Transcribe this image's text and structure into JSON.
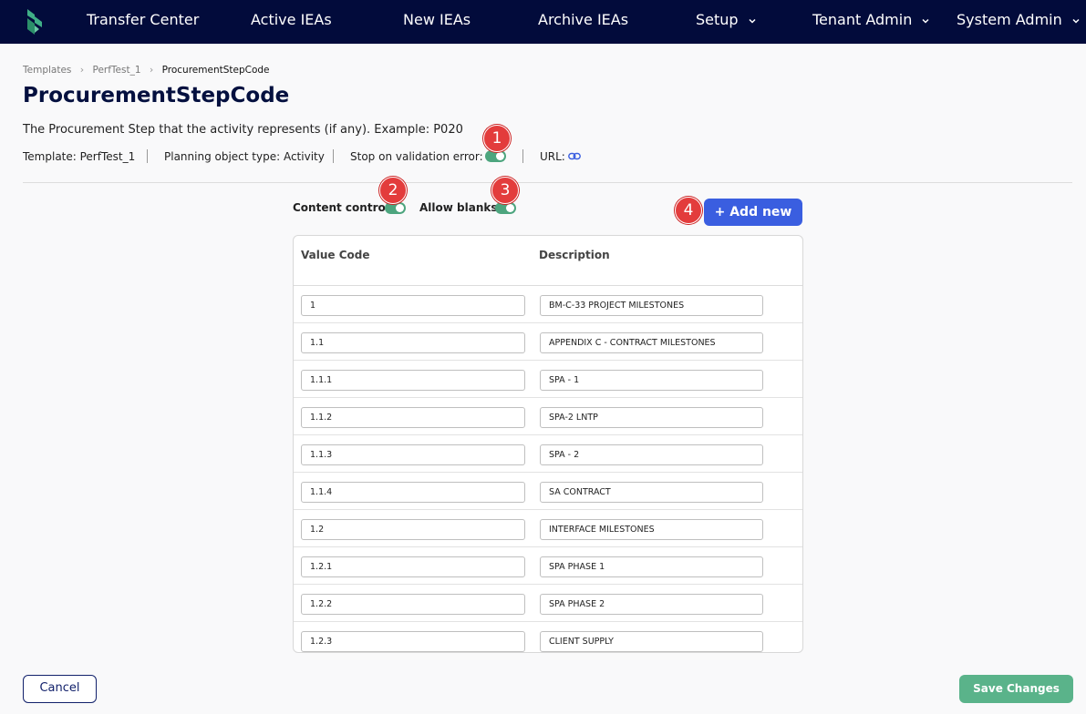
{
  "nav": {
    "items": [
      {
        "label": "Transfer Center"
      },
      {
        "label": "Active IEAs"
      },
      {
        "label": "New IEAs"
      },
      {
        "label": "Archive IEAs"
      },
      {
        "label": "Setup"
      },
      {
        "label": "Tenant Admin"
      },
      {
        "label": "System Admin"
      }
    ]
  },
  "breadcrumb": [
    "Templates",
    "PerfTest_1",
    "ProcurementStepCode"
  ],
  "page": {
    "title": "ProcurementStepCode",
    "description": "The Procurement Step that the activity represents (if any). Example: P020"
  },
  "meta": {
    "template": "Template: PerfTest_1",
    "planning_object_type": "Planning object type: Activity",
    "stop_on_validation_error_label": "Stop on validation error:",
    "stop_on_validation_error": true,
    "url_label": "URL:"
  },
  "controls": {
    "content_control_label": "Content control:",
    "content_control": true,
    "allow_blanks_label": "Allow blanks:",
    "allow_blanks": true,
    "add_new_label": "+ Add new"
  },
  "badges": [
    "1",
    "2",
    "3",
    "4"
  ],
  "table": {
    "columns": [
      "Value Code",
      "Description"
    ],
    "rows": [
      {
        "code": "1",
        "description": "BM-C-33  PROJECT MILESTONES"
      },
      {
        "code": "1.1",
        "description": "APPENDIX C - CONTRACT MILESTONES"
      },
      {
        "code": "1.1.1",
        "description": "SPA - 1"
      },
      {
        "code": "1.1.2",
        "description": "SPA-2 LNTP"
      },
      {
        "code": "1.1.3",
        "description": "SPA - 2"
      },
      {
        "code": "1.1.4",
        "description": "SA CONTRACT"
      },
      {
        "code": "1.2",
        "description": "INTERFACE MILESTONES"
      },
      {
        "code": "1.2.1",
        "description": "SPA PHASE 1"
      },
      {
        "code": "1.2.2",
        "description": "SPA PHASE 2"
      },
      {
        "code": "1.2.3",
        "description": "CLIENT SUPPLY"
      }
    ]
  },
  "footer": {
    "cancel_label": "Cancel",
    "save_label": "Save Changes"
  },
  "colors": {
    "nav_bg": "#020b3b",
    "toggle_on": "#4da57e",
    "primary_button": "#3a5ee0",
    "save_button": "#5ab38a",
    "badge": "#e33c3c"
  }
}
